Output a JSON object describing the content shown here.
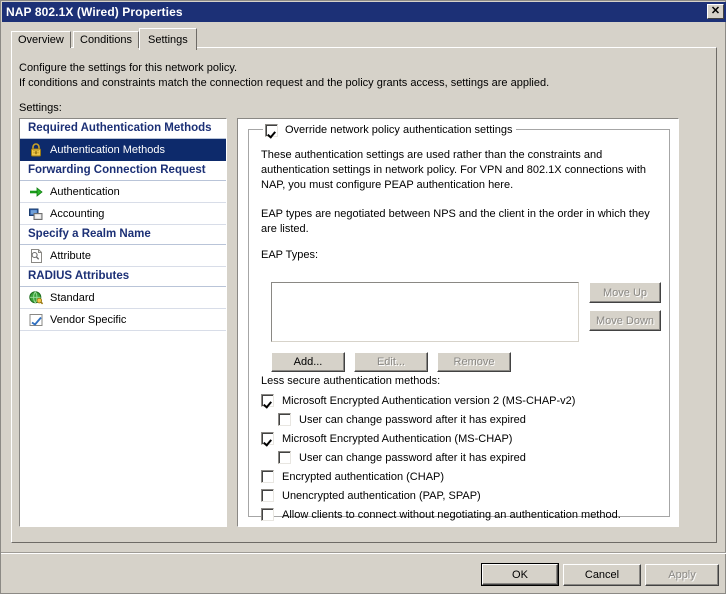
{
  "window": {
    "title": "NAP 802.1X (Wired) Properties",
    "close_label": "✕"
  },
  "tabs": [
    {
      "label": "Overview",
      "active": false
    },
    {
      "label": "Conditions",
      "active": false
    },
    {
      "label": "Settings",
      "active": true
    }
  ],
  "description": {
    "line1": "Configure the settings for this network policy.",
    "line2": "If conditions and constraints match the connection request and the policy grants access, settings are applied.",
    "settings_label": "Settings:"
  },
  "tree": [
    {
      "type": "header",
      "label": "Required Authentication Methods"
    },
    {
      "type": "item",
      "label": "Authentication Methods",
      "icon": "padlock-icon",
      "selected": true
    },
    {
      "type": "header",
      "label": "Forwarding Connection Request"
    },
    {
      "type": "item",
      "label": "Authentication",
      "icon": "green-arrow-icon",
      "selected": false
    },
    {
      "type": "item",
      "label": "Accounting",
      "icon": "monitors-icon",
      "selected": false
    },
    {
      "type": "header",
      "label": "Specify a Realm Name"
    },
    {
      "type": "item",
      "label": "Attribute",
      "icon": "document-search-icon",
      "selected": false
    },
    {
      "type": "header",
      "label": "RADIUS Attributes"
    },
    {
      "type": "item",
      "label": "Standard",
      "icon": "globe-key-icon",
      "selected": false
    },
    {
      "type": "item",
      "label": "Vendor Specific",
      "icon": "blue-check-icon",
      "selected": false
    }
  ],
  "group": {
    "title": "Override network policy authentication settings",
    "checked": true,
    "paragraph1": "These authentication settings are used rather than the constraints and authentication settings in network policy. For VPN and 802.1X connections with NAP, you must configure PEAP authentication here.",
    "paragraph2": "EAP types are negotiated between NPS and the client in the order in which they are listed.",
    "eap_label": "EAP Types:",
    "eap_items": []
  },
  "buttons": {
    "move_up": {
      "label": "Move Up",
      "enabled": false
    },
    "move_down": {
      "label": "Move Down",
      "enabled": false
    },
    "add": {
      "label": "Add...",
      "enabled": true
    },
    "edit": {
      "label": "Edit...",
      "enabled": false
    },
    "remove": {
      "label": "Remove",
      "enabled": false
    }
  },
  "less_secure": {
    "title": "Less secure authentication methods:",
    "options": [
      {
        "label": "Microsoft Encrypted Authentication version 2 (MS-CHAP-v2)",
        "checked": true,
        "indent": false
      },
      {
        "label": "User can change password after it has expired",
        "checked": false,
        "indent": true
      },
      {
        "label": "Microsoft Encrypted Authentication (MS-CHAP)",
        "checked": true,
        "indent": false
      },
      {
        "label": "User can change password after it has expired",
        "checked": false,
        "indent": true
      },
      {
        "label": "Encrypted authentication (CHAP)",
        "checked": false,
        "indent": false
      },
      {
        "label": "Unencrypted authentication (PAP, SPAP)",
        "checked": false,
        "indent": false
      },
      {
        "label": "Allow clients to connect without negotiating an authentication method.",
        "checked": false,
        "indent": false
      }
    ]
  },
  "dialog_buttons": {
    "ok": {
      "label": "OK",
      "enabled": true,
      "default": true
    },
    "cancel": {
      "label": "Cancel",
      "enabled": true
    },
    "apply": {
      "label": "Apply",
      "enabled": false
    }
  },
  "colors": {
    "titlebar": "#1c3076",
    "selection": "#0d2a6b",
    "header_text": "#1c3076",
    "face": "#d6d2c9"
  }
}
